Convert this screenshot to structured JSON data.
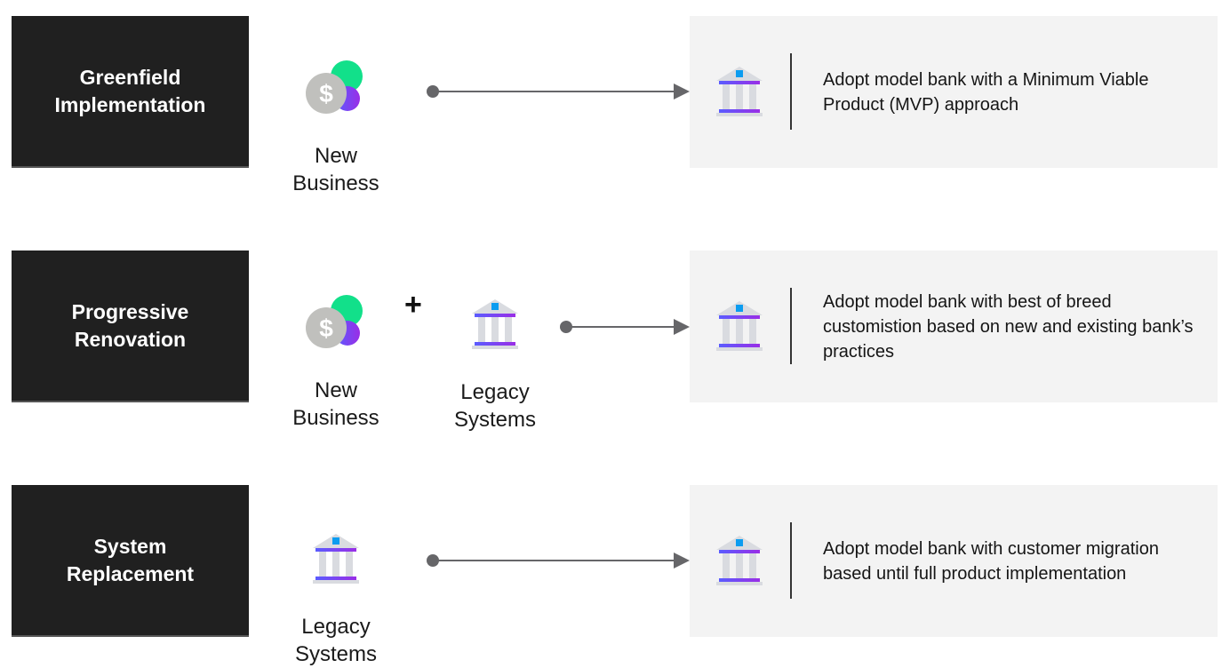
{
  "rows": [
    {
      "label": "Greenfield\nImplementation",
      "sources": [
        {
          "icon": "dollar-coin-icon",
          "label": "New\nBusiness"
        }
      ],
      "connector": "",
      "result_icon": "bank-icon",
      "result_text": "Adopt model bank with a Minimum Viable Product (MVP) approach"
    },
    {
      "label": "Progressive\nRenovation",
      "sources": [
        {
          "icon": "dollar-coin-icon",
          "label": "New\nBusiness"
        },
        {
          "icon": "bank-icon",
          "label": "Legacy\nSystems"
        }
      ],
      "connector": "+",
      "result_icon": "bank-icon",
      "result_text": "Adopt model bank with best of breed customistion based on new and existing bank’s practices"
    },
    {
      "label": "System\nReplacement",
      "sources": [
        {
          "icon": "bank-icon",
          "label": "Legacy\nSystems"
        }
      ],
      "connector": "",
      "result_icon": "bank-icon",
      "result_text": "Adopt model bank with customer migration based until full product implementation"
    }
  ],
  "colors": {
    "label_bg": "#202020",
    "result_bg": "#f3f3f3",
    "arrow": "#666669",
    "coin": "#c0c0bd",
    "green": "#12e08a",
    "purple": "#7b3ff5",
    "bank_gray": "#d9dbe0",
    "bank_accent": "#0b9cf0"
  }
}
